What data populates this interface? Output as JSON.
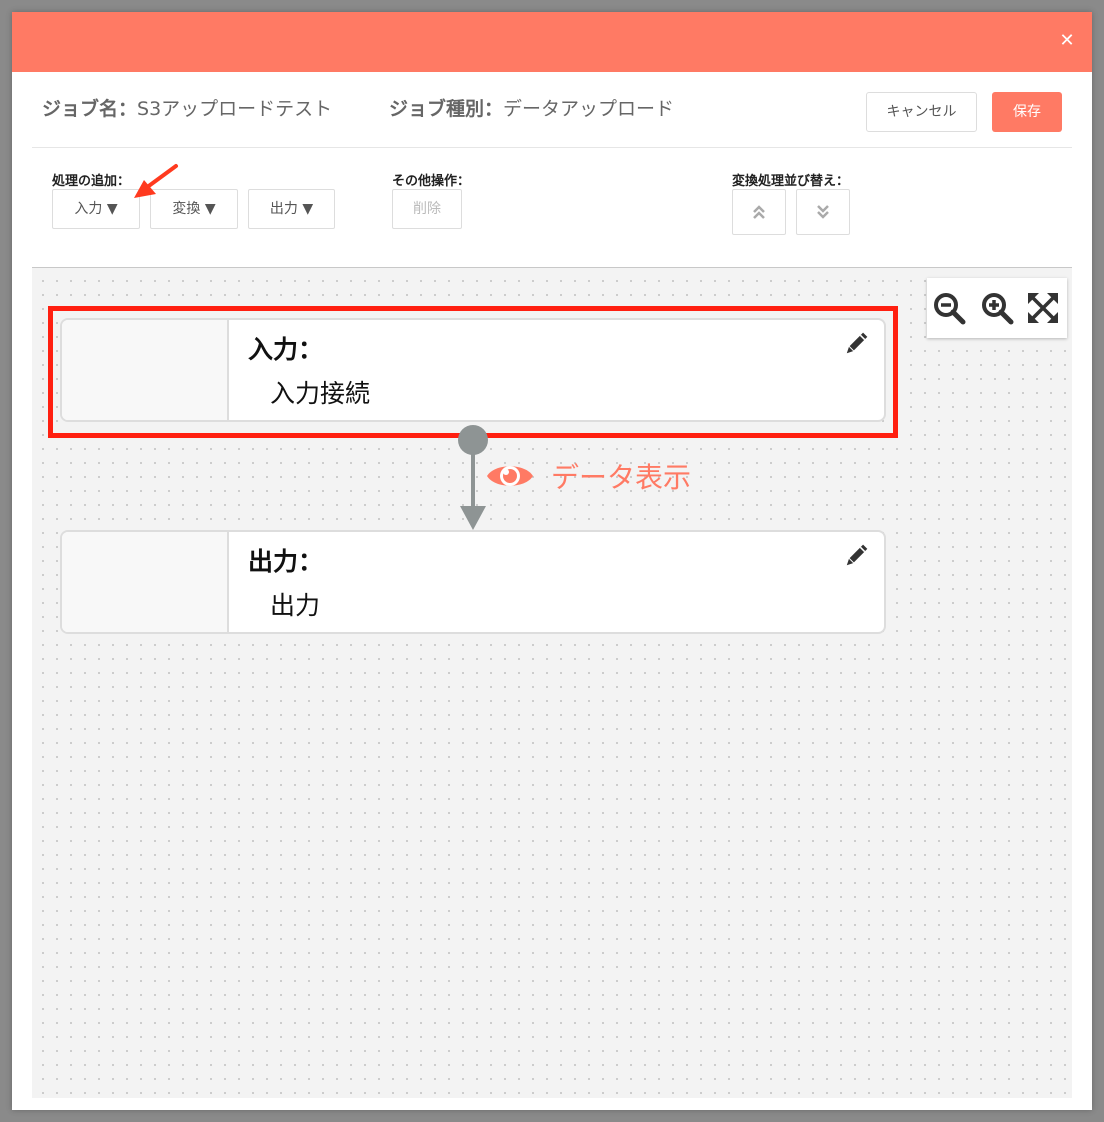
{
  "header": {
    "close_icon": "close-icon",
    "accent_color": "#ff7a64"
  },
  "job": {
    "name_label": "ジョブ名：",
    "name_value": "S3アップロードテスト",
    "type_label": "ジョブ種別：",
    "type_value": "データアップロード"
  },
  "actions": {
    "cancel_label": "キャンセル",
    "save_label": "保存"
  },
  "toolbar": {
    "add_label": "処理の追加：",
    "add_buttons": [
      "入力 ▼",
      "変換 ▼",
      "出力 ▼"
    ],
    "other_label": "その他操作：",
    "delete_label": "削除",
    "sort_label": "変換処理並び替え：",
    "sort_up_icon": "chevron-double-up-icon",
    "sort_down_icon": "chevron-double-down-icon"
  },
  "canvas": {
    "zoom_out_icon": "zoom-out-icon",
    "zoom_in_icon": "zoom-in-icon",
    "fit_icon": "fit-screen-icon",
    "nodes": [
      {
        "title": "入力：",
        "subtitle": "入力接続"
      },
      {
        "title": "出力：",
        "subtitle": "出力"
      }
    ],
    "data_view_label": "データ表示",
    "highlight_color": "#ff1f10"
  }
}
